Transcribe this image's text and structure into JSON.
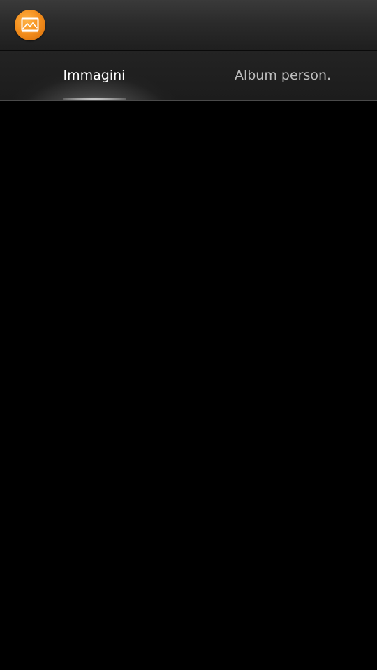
{
  "action_bar": {
    "app_icon": "gallery-picture-icon",
    "accent_color": "#f5901e"
  },
  "tabs": [
    {
      "label": "Immagini",
      "selected": true
    },
    {
      "label": "Album person.",
      "selected": false
    }
  ],
  "colors": {
    "background": "#000000",
    "tab_selected_text": "#ffffff",
    "tab_unselected_text": "#bdbdbd"
  }
}
